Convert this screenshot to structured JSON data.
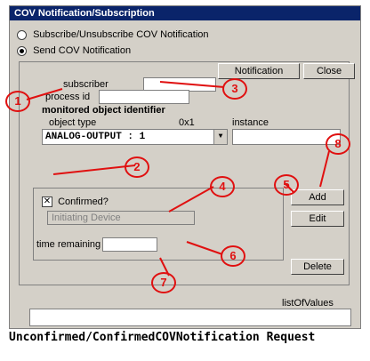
{
  "window": {
    "title": "COV Notification/Subscription"
  },
  "modes": {
    "subscribe_label": "Subscribe/Unsubscribe COV Notification",
    "send_label": "Send COV Notification",
    "selected": "send"
  },
  "buttons": {
    "send_notification": "Notification",
    "close": "Close",
    "add": "Add",
    "edit": "Edit",
    "delete": "Delete"
  },
  "fields": {
    "subscriber_label": "subscriber",
    "process_id_label": "process id",
    "monitored_label": "monitored object identifier",
    "object_type_label": "object type",
    "hex_prefix": "0x1",
    "instance_label": "instance",
    "object_type_value": "ANALOG-OUTPUT : 1",
    "confirmed_label": "Confirmed?",
    "initiating_device_label": "Initiating Device",
    "time_remaining_label": "time remaining",
    "list_of_values_label": "listOfValues"
  },
  "annotations": [
    "1",
    "2",
    "3",
    "4",
    "5",
    "6",
    "7",
    "8"
  ],
  "caption": "Unconfirmed/ConfirmedCOVNotification Request"
}
